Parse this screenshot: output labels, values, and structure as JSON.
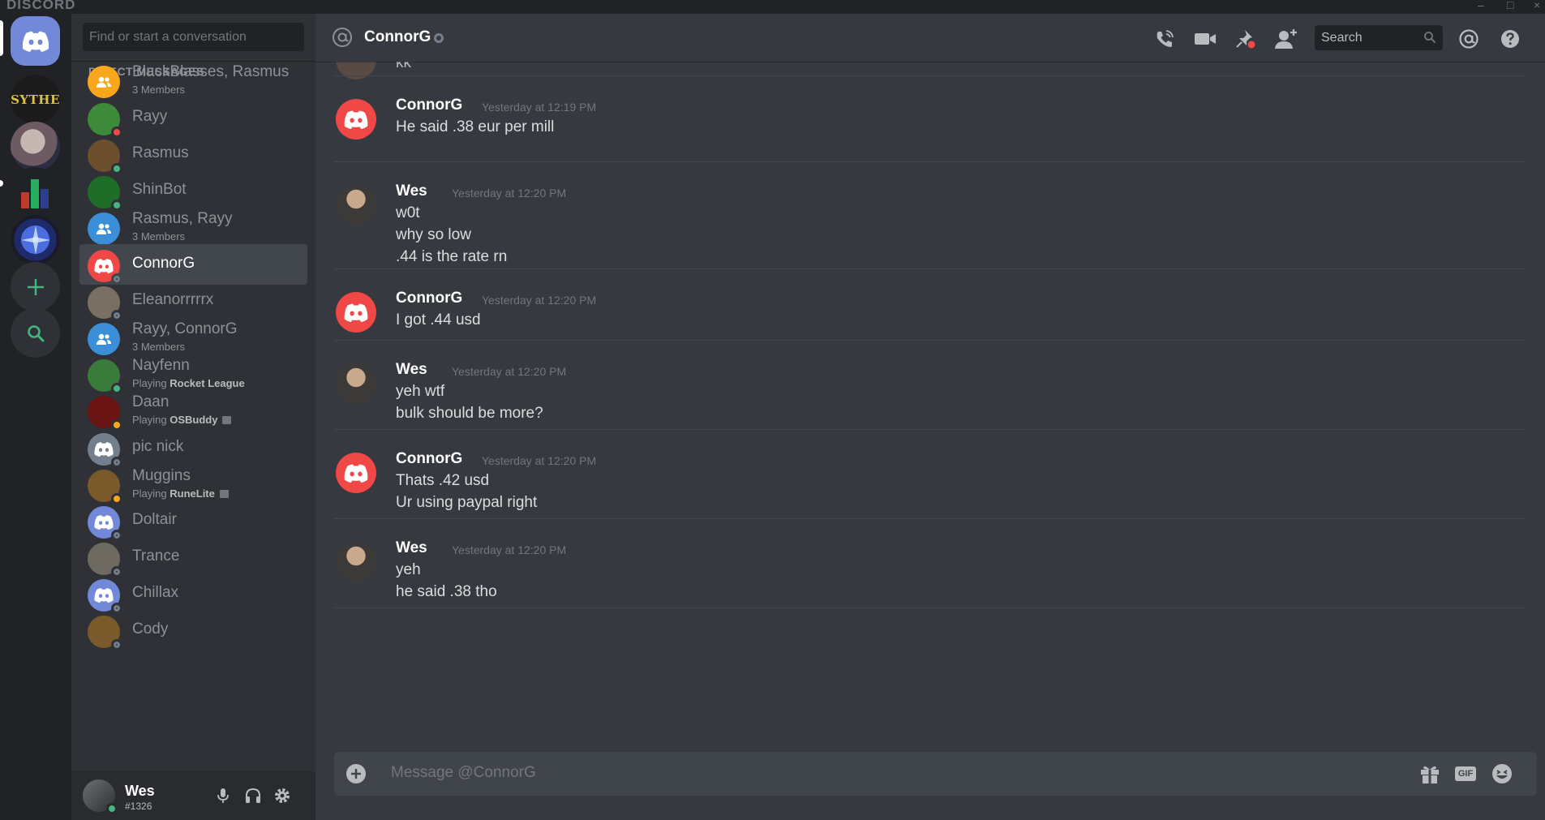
{
  "app": {
    "brand": "DISCORD"
  },
  "window": {
    "minimize": "–",
    "maximize": "□",
    "close": "×"
  },
  "servers": [
    {
      "name": "Home",
      "icon": "discord-logo-icon"
    },
    {
      "name": "SYTHE",
      "label": "SYTHE"
    },
    {
      "name": "server-avatar-2"
    },
    {
      "name": "server-chart"
    },
    {
      "name": "server-compass"
    },
    {
      "name": "Add a Server",
      "icon": "plus-icon"
    },
    {
      "name": "Server Discovery",
      "icon": "search-icon"
    }
  ],
  "dm_sidebar": {
    "search_placeholder": "Find or start a conversation",
    "header": "DIRECT MESSAGES",
    "items": [
      {
        "name": "BlackBlasses, Rasmus",
        "sub": "3 Members",
        "type": "group",
        "color": "#faa61a"
      },
      {
        "name": "Rayy",
        "status": "dnd",
        "color": "#3d8a3a"
      },
      {
        "name": "Rasmus",
        "status": "online",
        "color": "#6b4e2e"
      },
      {
        "name": "ShinBot",
        "status": "online",
        "color": "#1e6e2a"
      },
      {
        "name": "Rasmus, Rayy",
        "sub": "3 Members",
        "type": "group",
        "color": "#3b8fd9"
      },
      {
        "name": "ConnorG",
        "status": "offline",
        "color": "#f04747",
        "active": true
      },
      {
        "name": "Eleanorrrrrx",
        "status": "offline",
        "color": "#7a6f63"
      },
      {
        "name": "Rayy, ConnorG",
        "sub": "3 Members",
        "type": "group",
        "color": "#3b8fd9"
      },
      {
        "name": "Nayfenn",
        "sub_prefix": "Playing ",
        "sub_game": "Rocket League",
        "status": "online",
        "color": "#3a7a3a"
      },
      {
        "name": "Daan",
        "sub_prefix": "Playing ",
        "sub_game": "OSBuddy",
        "status": "idle",
        "color": "#6a1414",
        "rich": true
      },
      {
        "name": "pic nick",
        "status": "offline",
        "color": "#747f8d"
      },
      {
        "name": "Muggins",
        "sub_prefix": "Playing ",
        "sub_game": "RuneLite",
        "status": "idle",
        "color": "#7a5a2a",
        "rich": true
      },
      {
        "name": "Doltair",
        "status": "offline",
        "color": "#7289da"
      },
      {
        "name": "Trance",
        "status": "offline",
        "color": "#6e6a62"
      },
      {
        "name": "Chillax",
        "status": "offline",
        "color": "#7289da"
      },
      {
        "name": "Cody",
        "status": "offline",
        "color": "#7a5a2a"
      }
    ]
  },
  "user_panel": {
    "name": "Wes",
    "tag": "#1326"
  },
  "chat_header": {
    "channel": "ConnorG",
    "search_placeholder": "Search",
    "icons": [
      "phone-call-icon",
      "video-icon",
      "pin-icon",
      "add-friend-icon",
      "mention-icon",
      "help-icon"
    ]
  },
  "messages": [
    {
      "author": "ConnorG",
      "time": "Yesterday at 12:19 PM",
      "lines": [
        "He said .38 eur per mill"
      ],
      "avatar": "discord"
    },
    {
      "author": "Wes",
      "time": "Yesterday at 12:20 PM",
      "lines": [
        "w0t",
        "why so low",
        ".44 is the rate rn"
      ],
      "avatar": "wes"
    },
    {
      "author": "ConnorG",
      "time": "Yesterday at 12:20 PM",
      "lines": [
        "I got .44 usd"
      ],
      "avatar": "discord"
    },
    {
      "author": "Wes",
      "time": "Yesterday at 12:20 PM",
      "lines": [
        "yeh wtf",
        "bulk should be more?"
      ],
      "avatar": "wes"
    },
    {
      "author": "ConnorG",
      "time": "Yesterday at 12:20 PM",
      "lines": [
        "Thats .42 usd",
        "Ur using paypal right"
      ],
      "avatar": "discord"
    },
    {
      "author": "Wes",
      "time": "Yesterday at 12:20 PM",
      "lines": [
        "yeh",
        "he said .38 tho"
      ],
      "avatar": "wes"
    }
  ],
  "partial_top_message": {
    "text": "kk"
  },
  "composer": {
    "placeholder": "Message @ConnorG",
    "gif_label": "GIF"
  }
}
